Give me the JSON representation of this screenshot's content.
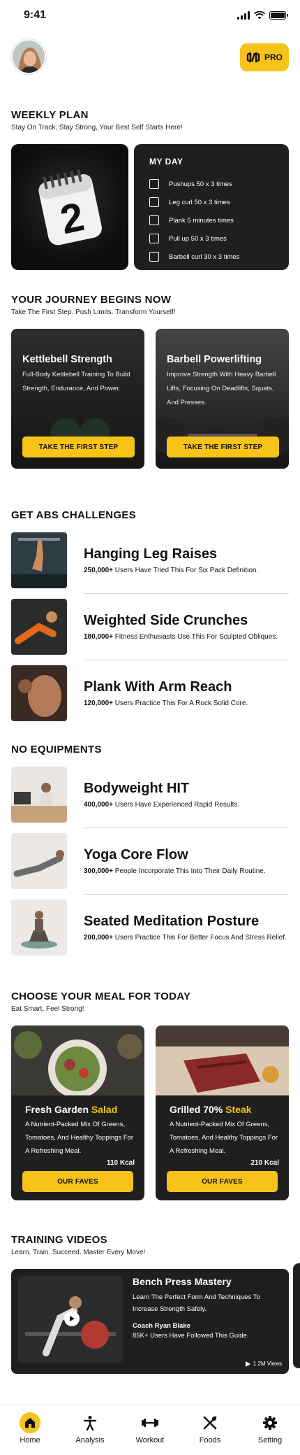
{
  "status_bar": {
    "time": "9:41"
  },
  "header": {
    "pro_label": "PRO"
  },
  "weekly_plan": {
    "title": "WEEKLY PLAN",
    "subtitle": "Stay On Track, Stay Strong, Your Best Self Starts Here!",
    "calendar_day": "2",
    "my_day": {
      "title": "MY DAY",
      "tasks": [
        "Pushups 50 x 3 times",
        "Leg curl 50 x 3 times",
        "Plank 5 minutes times",
        "Pull up 50 x 3 times",
        "Barbell curl 30 x 3 times"
      ]
    }
  },
  "journey": {
    "title": "YOUR JOURNEY BEGINS NOW",
    "subtitle": "Take The First Step. Push Limits. Transform Yourself!",
    "cards": [
      {
        "title": "Kettlebell Strength",
        "desc": "Full-Body Kettlebell Training To Build Strength, Endurance, And Power.",
        "button": "TAKE THE FIRST STEP"
      },
      {
        "title": "Barbell Powerlifting",
        "desc": "Improve Strength With Heavy Barbell Lifts, Focusing On Deadlifts, Squats, And Presses.",
        "button": "TAKE THE FIRST STEP"
      }
    ]
  },
  "abs": {
    "title": "GET ABS CHALLENGES",
    "items": [
      {
        "title": "Hanging Leg Raises",
        "count": "250,000+",
        "text": "Users Have Tried This For Six Pack Definition."
      },
      {
        "title": "Weighted Side Crunches",
        "count": "180,000+",
        "text": "Fitness Enthusiasts Use This For Sculpted Obliques."
      },
      {
        "title": "Plank With Arm Reach",
        "count": "120,000+",
        "text": "Users Practice This For A Rock Solid Core."
      }
    ]
  },
  "equipments": {
    "title": "NO EQUIPMENTS",
    "items": [
      {
        "title": "Bodyweight HIT",
        "count": "400,000+",
        "text": "Users Have Experienced Rapid Results."
      },
      {
        "title": "Yoga Core Flow",
        "count": "300,000+",
        "text": "People Incorporate This Into Their Daily Routine."
      },
      {
        "title": "Seated Meditation Posture",
        "count": "200,000+",
        "text": "Users Practice This For Better Focus And Stress Relief."
      }
    ]
  },
  "meal": {
    "title": "CHOOSE YOUR MEAL FOR TODAY",
    "subtitle": "Eat Smart, Feel Strong!",
    "cards": [
      {
        "title": "Fresh Garden",
        "accent": "Salad",
        "desc": "A Nutrient-Packed Mix Of Greens, Tomatoes, And Healthy Toppings For A Refreshing Meal.",
        "kcal": "110 Kcal",
        "button": "OUR FAVES"
      },
      {
        "title": "Grilled 70%",
        "accent": "Steak",
        "desc": "A Nutrient-Packed Mix Of Greens, Tomatoes, And Healthy Toppings For A Refreshing Meal.",
        "kcal": "210 Kcal",
        "button": "OUR FAVES"
      }
    ]
  },
  "videos": {
    "title": "TRAINING VIDEOS",
    "subtitle": "Learn. Train. Succeed. Master Every Move!",
    "card": {
      "title": "Bench Press Mastery",
      "desc": "Learn The Perfect Form And Techniques To Increase Strength Safely.",
      "coach": "Coach Ryan Blake",
      "followers": "85K+ Users Have Followed This Guide.",
      "views": "1.2M Views"
    }
  },
  "nav": {
    "items": [
      {
        "label": "Home",
        "icon": "home-icon"
      },
      {
        "label": "Analysis",
        "icon": "person-icon"
      },
      {
        "label": "Workout",
        "icon": "dumbbell-icon"
      },
      {
        "label": "Foods",
        "icon": "utensils-icon"
      },
      {
        "label": "Setting",
        "icon": "gear-icon"
      }
    ]
  },
  "colors": {
    "accent": "#f7c21a",
    "card_dark": "#1f1f1f"
  }
}
